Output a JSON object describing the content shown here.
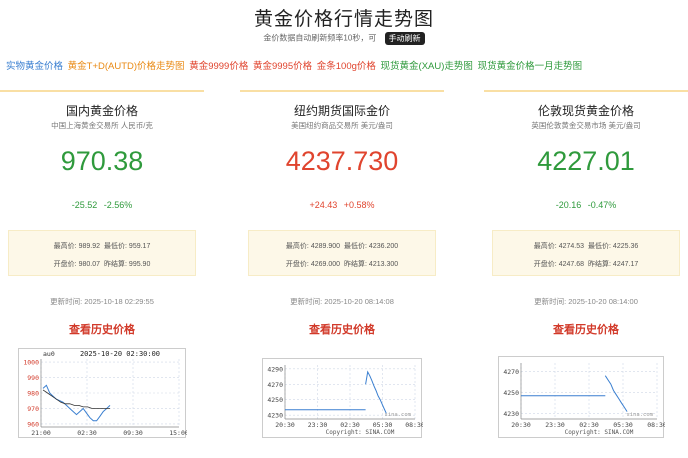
{
  "header": {
    "title": "黄金价格行情走势图",
    "subtitle": "金价数据自动刷新频率10秒，可",
    "refresh_button": "手动刷新"
  },
  "nav": {
    "links": [
      {
        "label": "实物黄金价格",
        "color": "#3a7fd0"
      },
      {
        "label": "黄金T+D(AUTD)价格走势图",
        "color": "#e98a14"
      },
      {
        "label": "黄金9999价格",
        "color": "#e0442e"
      },
      {
        "label": "黄金9995价格",
        "color": "#e0442e"
      },
      {
        "label": "金条100g价格",
        "color": "#e0442e"
      },
      {
        "label": "现货黄金(XAU)走势图",
        "color": "#2f9a3c"
      },
      {
        "label": "现货黄金价格一月走势图",
        "color": "#2f9a3c"
      }
    ]
  },
  "colors": {
    "up": "#e0442e",
    "down": "#2f9a3c",
    "link": "#d23a2a"
  },
  "cards": [
    {
      "name": "国内黄金价格",
      "source": "中国上海黄金交易所 人民币/克",
      "price": "970.38",
      "change": "-25.52",
      "change_pct": "-2.56%",
      "direction": "down",
      "high_label": "最高价:",
      "high": "989.92",
      "low_label": "最低价:",
      "low": "959.17",
      "open_label": "开盘价:",
      "open": "980.07",
      "prev_label": "昨结算:",
      "prev": "995.90",
      "time": "更新时间: 2025-10-18 02:29:55",
      "history_link": "查看历史价格"
    },
    {
      "name": "纽约期货国际金价",
      "source": "美国纽约商品交易所 美元/盎司",
      "price": "4237.730",
      "change": "+24.43",
      "change_pct": "+0.58%",
      "direction": "up",
      "high_label": "最高价:",
      "high": "4289.900",
      "low_label": "最低价:",
      "low": "4236.200",
      "open_label": "开盘价:",
      "open": "4269.000",
      "prev_label": "昨结算:",
      "prev": "4213.300",
      "time": "更新时间: 2025-10-20 08:14:08",
      "history_link": "查看历史价格"
    },
    {
      "name": "伦敦现货黄金价格",
      "source": "英国伦敦黄金交易市场 美元/盎司",
      "price": "4227.01",
      "change": "-20.16",
      "change_pct": "-0.47%",
      "direction": "down",
      "high_label": "最高价:",
      "high": "4274.53",
      "low_label": "最低价:",
      "low": "4225.36",
      "open_label": "开盘价:",
      "open": "4247.68",
      "prev_label": "昨结算:",
      "prev": "4247.17",
      "time": "更新时间: 2025-10-20 08:14:00",
      "history_link": "查看历史价格"
    }
  ],
  "chart_data": [
    {
      "type": "line",
      "header_left": "au0",
      "header_time": "2025-10-20 02:30:00",
      "y_ticks": [
        960,
        970,
        980,
        990,
        1000
      ],
      "ylim": [
        958,
        1002
      ],
      "x_ticks": [
        "21:00",
        "02:30",
        "09:30",
        "15:00"
      ],
      "series": [
        {
          "values": [
            983,
            985,
            980,
            978,
            976,
            975,
            974,
            972,
            970,
            968,
            966,
            968,
            970,
            967,
            964,
            962,
            962,
            965,
            968,
            970,
            972
          ]
        }
      ],
      "avg": [
        982,
        980,
        978,
        976,
        974,
        973,
        973,
        972,
        972,
        971,
        971,
        970,
        970,
        970,
        970,
        970
      ]
    },
    {
      "type": "line",
      "y_ticks": [
        4230,
        4250,
        4270,
        4290
      ],
      "ylim": [
        4225,
        4295
      ],
      "x_ticks": [
        "20:30",
        "23:30",
        "02:30",
        "05:30",
        "08:30"
      ],
      "baseline": 4237,
      "series": [
        {
          "values": [
            4270,
            4286,
            4281,
            4275,
            4268,
            4262,
            4255,
            4250,
            4244,
            4238,
            4232
          ]
        }
      ],
      "watermark": "sina.com",
      "copyright": "Copyright: SINA.COM"
    },
    {
      "type": "line",
      "y_ticks": [
        4230,
        4250,
        4270
      ],
      "ylim": [
        4225,
        4278
      ],
      "x_ticks": [
        "20:30",
        "23:30",
        "02:30",
        "05:30",
        "08:30"
      ],
      "baseline": 4247,
      "series": [
        {
          "values": [
            4266,
            4262,
            4258,
            4252,
            4248,
            4244,
            4240,
            4236,
            4232
          ]
        }
      ],
      "watermark": "sina.com",
      "copyright": "Copyright: SINA.COM"
    }
  ]
}
